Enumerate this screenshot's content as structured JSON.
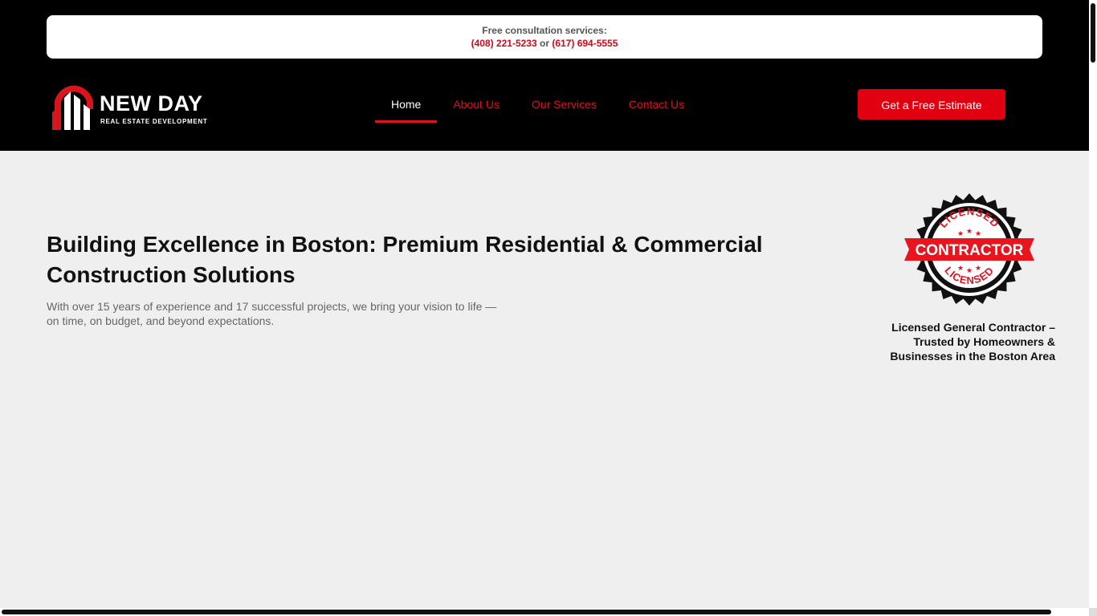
{
  "topbar": {
    "label": "Free consultation services:",
    "phone1": "(408) 221-5233",
    "separator": "or",
    "phone2": "(617) 694-5555"
  },
  "logo": {
    "name": "NEW DAY",
    "tagline": "REAL ESTATE DEVELOPMENT"
  },
  "nav": {
    "items": [
      {
        "label": "Home",
        "active": true
      },
      {
        "label": "About Us"
      },
      {
        "label": "Our Services"
      },
      {
        "label": "Contact Us"
      }
    ]
  },
  "cta": {
    "label": "Get a Free Estimate"
  },
  "hero": {
    "title": "Building Excellence in Boston: Premium Residential & Commercial Construction Solutions",
    "subtitle": "With over 15 years of experience and 17 successful projects, we bring your vision to life — on time, on budget, and beyond expectations."
  },
  "badge": {
    "top_text": "LICENSED",
    "main_text": "CONTRACTOR",
    "bottom_text": "LICENSED",
    "caption": "Licensed General Contractor – Trusted by Homeowners & Businesses in the Boston Area"
  },
  "colors": {
    "accent": "#e0000f",
    "header_bg": "#000000",
    "page_bg": "#f0eff0"
  },
  "icons": {
    "logo": "building-arch-logo-icon",
    "badge": "seal-badge-icon"
  }
}
